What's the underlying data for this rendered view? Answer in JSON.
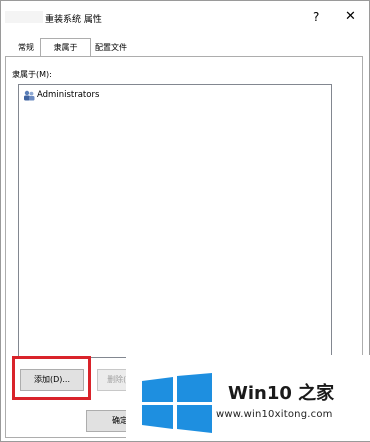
{
  "window": {
    "title": "重装系统 属性",
    "help_label": "?",
    "close_label": "✕"
  },
  "tabs": [
    {
      "label": "常规"
    },
    {
      "label": "隶属于"
    },
    {
      "label": "配置文件"
    }
  ],
  "member_of": {
    "label": "隶属于(M):",
    "items": [
      {
        "label": "Administrators",
        "icon": "user-group-icon"
      }
    ]
  },
  "buttons": {
    "add_label": "添加(D)...",
    "remove_label": "删除(R)",
    "ok_label": "确定"
  },
  "watermark": {
    "brand": "Win10 之家",
    "url": "www.win10xitong.com"
  },
  "colors": {
    "highlight": "#d9232a",
    "windows_blue": "#1e8fe0"
  }
}
